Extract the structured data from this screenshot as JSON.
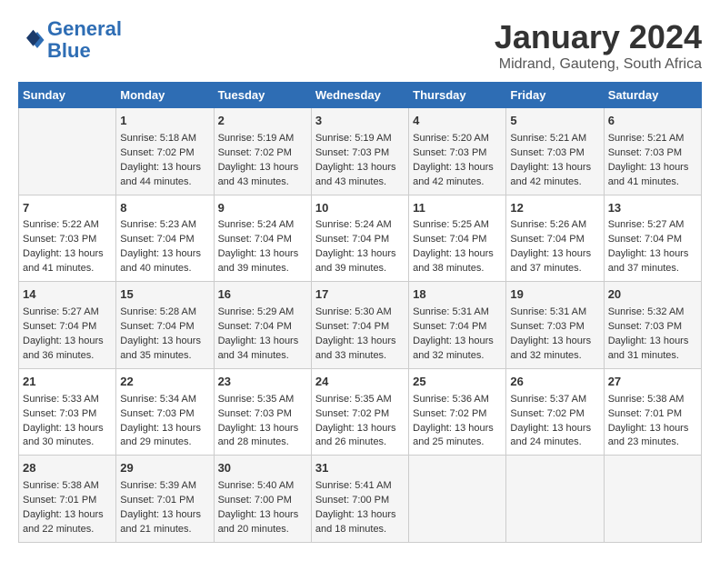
{
  "logo": {
    "line1": "General",
    "line2": "Blue"
  },
  "title": "January 2024",
  "subtitle": "Midrand, Gauteng, South Africa",
  "header_color": "#2e6db4",
  "days_of_week": [
    "Sunday",
    "Monday",
    "Tuesday",
    "Wednesday",
    "Thursday",
    "Friday",
    "Saturday"
  ],
  "weeks": [
    [
      {
        "day": "",
        "content": ""
      },
      {
        "day": "1",
        "content": "Sunrise: 5:18 AM\nSunset: 7:02 PM\nDaylight: 13 hours\nand 44 minutes."
      },
      {
        "day": "2",
        "content": "Sunrise: 5:19 AM\nSunset: 7:02 PM\nDaylight: 13 hours\nand 43 minutes."
      },
      {
        "day": "3",
        "content": "Sunrise: 5:19 AM\nSunset: 7:03 PM\nDaylight: 13 hours\nand 43 minutes."
      },
      {
        "day": "4",
        "content": "Sunrise: 5:20 AM\nSunset: 7:03 PM\nDaylight: 13 hours\nand 42 minutes."
      },
      {
        "day": "5",
        "content": "Sunrise: 5:21 AM\nSunset: 7:03 PM\nDaylight: 13 hours\nand 42 minutes."
      },
      {
        "day": "6",
        "content": "Sunrise: 5:21 AM\nSunset: 7:03 PM\nDaylight: 13 hours\nand 41 minutes."
      }
    ],
    [
      {
        "day": "7",
        "content": "Sunrise: 5:22 AM\nSunset: 7:03 PM\nDaylight: 13 hours\nand 41 minutes."
      },
      {
        "day": "8",
        "content": "Sunrise: 5:23 AM\nSunset: 7:04 PM\nDaylight: 13 hours\nand 40 minutes."
      },
      {
        "day": "9",
        "content": "Sunrise: 5:24 AM\nSunset: 7:04 PM\nDaylight: 13 hours\nand 39 minutes."
      },
      {
        "day": "10",
        "content": "Sunrise: 5:24 AM\nSunset: 7:04 PM\nDaylight: 13 hours\nand 39 minutes."
      },
      {
        "day": "11",
        "content": "Sunrise: 5:25 AM\nSunset: 7:04 PM\nDaylight: 13 hours\nand 38 minutes."
      },
      {
        "day": "12",
        "content": "Sunrise: 5:26 AM\nSunset: 7:04 PM\nDaylight: 13 hours\nand 37 minutes."
      },
      {
        "day": "13",
        "content": "Sunrise: 5:27 AM\nSunset: 7:04 PM\nDaylight: 13 hours\nand 37 minutes."
      }
    ],
    [
      {
        "day": "14",
        "content": "Sunrise: 5:27 AM\nSunset: 7:04 PM\nDaylight: 13 hours\nand 36 minutes."
      },
      {
        "day": "15",
        "content": "Sunrise: 5:28 AM\nSunset: 7:04 PM\nDaylight: 13 hours\nand 35 minutes."
      },
      {
        "day": "16",
        "content": "Sunrise: 5:29 AM\nSunset: 7:04 PM\nDaylight: 13 hours\nand 34 minutes."
      },
      {
        "day": "17",
        "content": "Sunrise: 5:30 AM\nSunset: 7:04 PM\nDaylight: 13 hours\nand 33 minutes."
      },
      {
        "day": "18",
        "content": "Sunrise: 5:31 AM\nSunset: 7:04 PM\nDaylight: 13 hours\nand 32 minutes."
      },
      {
        "day": "19",
        "content": "Sunrise: 5:31 AM\nSunset: 7:03 PM\nDaylight: 13 hours\nand 32 minutes."
      },
      {
        "day": "20",
        "content": "Sunrise: 5:32 AM\nSunset: 7:03 PM\nDaylight: 13 hours\nand 31 minutes."
      }
    ],
    [
      {
        "day": "21",
        "content": "Sunrise: 5:33 AM\nSunset: 7:03 PM\nDaylight: 13 hours\nand 30 minutes."
      },
      {
        "day": "22",
        "content": "Sunrise: 5:34 AM\nSunset: 7:03 PM\nDaylight: 13 hours\nand 29 minutes."
      },
      {
        "day": "23",
        "content": "Sunrise: 5:35 AM\nSunset: 7:03 PM\nDaylight: 13 hours\nand 28 minutes."
      },
      {
        "day": "24",
        "content": "Sunrise: 5:35 AM\nSunset: 7:02 PM\nDaylight: 13 hours\nand 26 minutes."
      },
      {
        "day": "25",
        "content": "Sunrise: 5:36 AM\nSunset: 7:02 PM\nDaylight: 13 hours\nand 25 minutes."
      },
      {
        "day": "26",
        "content": "Sunrise: 5:37 AM\nSunset: 7:02 PM\nDaylight: 13 hours\nand 24 minutes."
      },
      {
        "day": "27",
        "content": "Sunrise: 5:38 AM\nSunset: 7:01 PM\nDaylight: 13 hours\nand 23 minutes."
      }
    ],
    [
      {
        "day": "28",
        "content": "Sunrise: 5:38 AM\nSunset: 7:01 PM\nDaylight: 13 hours\nand 22 minutes."
      },
      {
        "day": "29",
        "content": "Sunrise: 5:39 AM\nSunset: 7:01 PM\nDaylight: 13 hours\nand 21 minutes."
      },
      {
        "day": "30",
        "content": "Sunrise: 5:40 AM\nSunset: 7:00 PM\nDaylight: 13 hours\nand 20 minutes."
      },
      {
        "day": "31",
        "content": "Sunrise: 5:41 AM\nSunset: 7:00 PM\nDaylight: 13 hours\nand 18 minutes."
      },
      {
        "day": "",
        "content": ""
      },
      {
        "day": "",
        "content": ""
      },
      {
        "day": "",
        "content": ""
      }
    ]
  ]
}
